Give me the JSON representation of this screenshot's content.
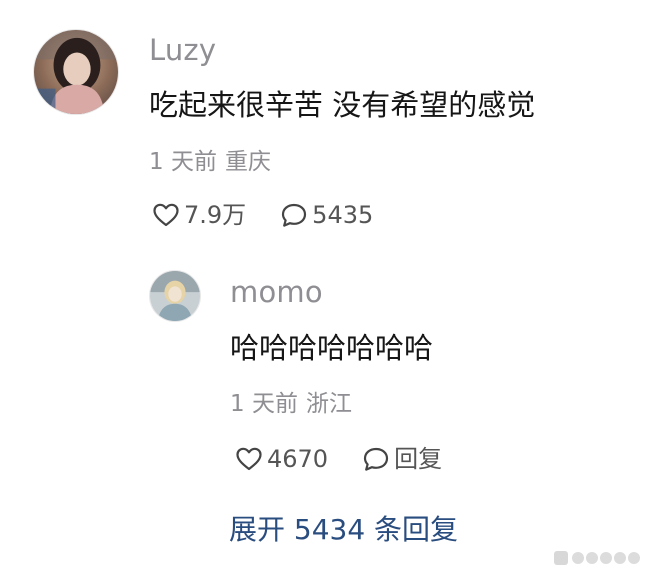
{
  "comment": {
    "username": "Luzy",
    "text": "吃起来很辛苦 没有希望的感觉",
    "time": "1 天前",
    "location": "重庆",
    "like_count": "7.9万",
    "reply_count": "5435",
    "like_icon": "heart-outline-icon",
    "reply_icon": "speech-bubble-icon"
  },
  "reply": {
    "username": "momo",
    "text": "哈哈哈哈哈哈哈",
    "time": "1 天前",
    "location": "浙江",
    "like_count": "4670",
    "reply_label": "回复",
    "like_icon": "heart-outline-icon",
    "reply_icon": "speech-bubble-icon"
  },
  "expand_replies_label": "展开 5434 条回复",
  "colors": {
    "username": "#8e8e93",
    "text": "#161616",
    "meta": "#8e8e93",
    "link": "#2a4d7f"
  }
}
